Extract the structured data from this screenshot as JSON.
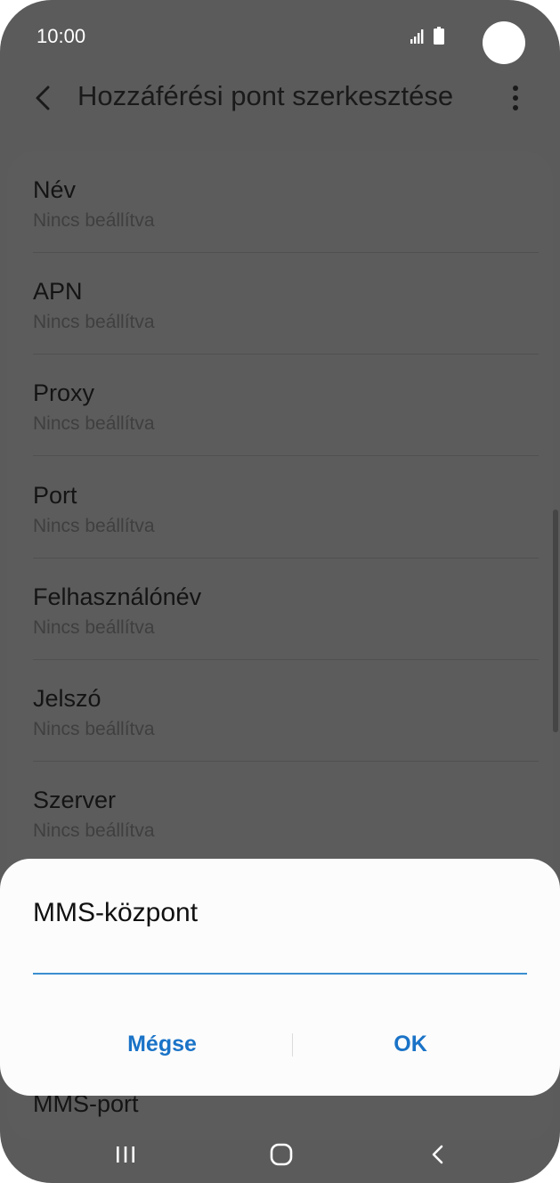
{
  "status": {
    "time": "10:00",
    "signal_icon": "signal-icon",
    "battery_icon": "battery-icon"
  },
  "header": {
    "title": "Hozzáférési pont szerkesztése",
    "back_icon": "back-arrow-icon",
    "more_icon": "more-vert-icon"
  },
  "settings": {
    "items": [
      {
        "label": "Név",
        "value": "Nincs beállítva"
      },
      {
        "label": "APN",
        "value": "Nincs beállítva"
      },
      {
        "label": "Proxy",
        "value": "Nincs beállítva"
      },
      {
        "label": "Port",
        "value": "Nincs beállítva"
      },
      {
        "label": "Felhasználónév",
        "value": "Nincs beállítva"
      },
      {
        "label": "Jelszó",
        "value": "Nincs beállítva"
      },
      {
        "label": "Szerver",
        "value": "Nincs beállítva"
      }
    ],
    "partial_item_label": "MMS-port"
  },
  "dialog": {
    "title": "MMS-központ",
    "input_value": "",
    "cancel_label": "Mégse",
    "ok_label": "OK",
    "accent_color": "#1a73c7"
  },
  "navbar": {
    "recents_icon": "recents-icon",
    "home_icon": "home-icon",
    "back_icon": "back-icon"
  }
}
